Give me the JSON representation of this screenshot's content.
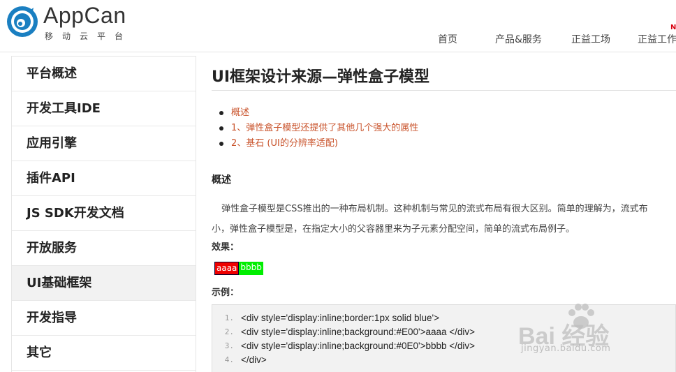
{
  "header": {
    "brand": "AppCan",
    "brand_sub": "移动云平台",
    "nav": [
      {
        "label": "首页"
      },
      {
        "label": "产品&服务"
      },
      {
        "label": "正益工场"
      },
      {
        "label": "正益工作"
      }
    ],
    "nav_badge": "N",
    "accent_color": "#1a7fc1"
  },
  "sidebar": {
    "items": [
      {
        "label": "平台概述"
      },
      {
        "label": "开发工具IDE"
      },
      {
        "label": "应用引擎"
      },
      {
        "label": "插件API"
      },
      {
        "label": "JS SDK开发文档"
      },
      {
        "label": "开放服务"
      },
      {
        "label": "UI基础框架"
      },
      {
        "label": "开发指导"
      },
      {
        "label": "其它"
      }
    ],
    "active_index": 6
  },
  "main": {
    "title": "UI框架设计来源—弹性盒子模型",
    "toc": [
      {
        "label": "概述"
      },
      {
        "label": "1、弹性盒子模型还提供了其他几个强大的属性"
      },
      {
        "label": "2、基石 (UI的分辨率适配)"
      }
    ],
    "section_title": "概述",
    "para_line1": "弹性盒子模型是CSS推出的一种布局机制。这种机制与常见的流式布局有很大区别。简单的理解为，流式布",
    "para_line2": "小，弹性盒子模型是，在指定大小的父容器里来为子元素分配空间，简单的流式布局例子。",
    "effect_label": "效果：",
    "demo_a": "aaaa",
    "demo_b": "bbbb",
    "example_label": "示例：",
    "code": [
      {
        "n": "1.",
        "text": "<div style='display:inline;border:1px solid blue'>"
      },
      {
        "n": "2.",
        "text": "<div style='display:inline;background:#E00'>aaaa </div>"
      },
      {
        "n": "3.",
        "text": "<div style='display:inline;background:#0E0'>bbbb </div>"
      },
      {
        "n": "4.",
        "text": "</div>"
      }
    ],
    "link_color": "#c9532b"
  },
  "watermark": {
    "text": "Bai  经验",
    "url": "jingyan.baidu.com"
  }
}
